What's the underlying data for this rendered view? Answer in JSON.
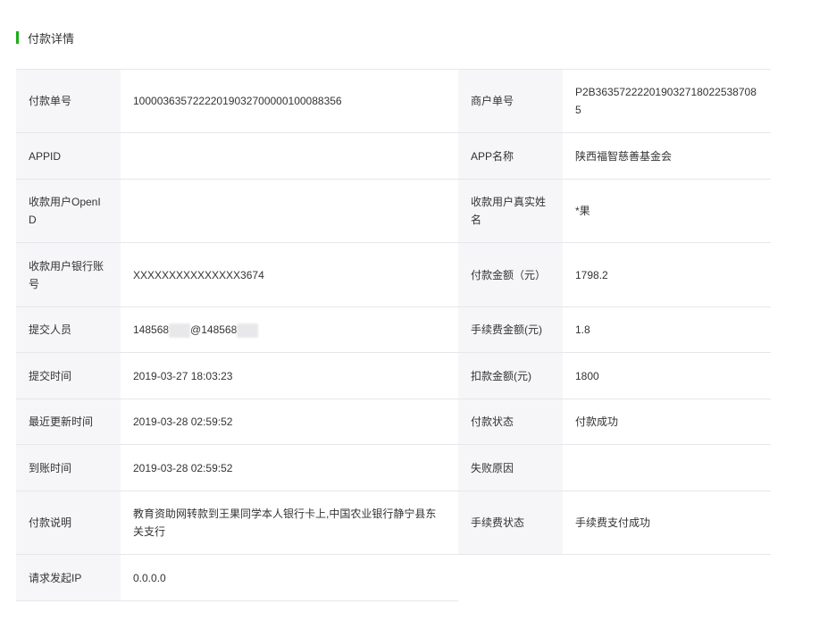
{
  "header": {
    "title": "付款详情"
  },
  "rows": [
    {
      "label_left": "付款单号",
      "value_left": "10000363572222019032700000100088356",
      "label_right": "商户单号",
      "value_right": "P2B363572222019032718022538708 5"
    },
    {
      "label_left": "APPID",
      "value_left": "",
      "label_right": "APP名称",
      "value_right": "陕西福智慈善基金会"
    },
    {
      "label_left": "收款用户OpenID",
      "value_left": "",
      "label_right": "收款用户真实姓名",
      "value_right": "*果"
    },
    {
      "label_left": "收款用户银行账号",
      "value_left": "XXXXXXXXXXXXXXX3674",
      "label_right": "付款金额（元）",
      "value_right": "1798.2"
    },
    {
      "label_left": "提交人员",
      "value_left_part1": "148568",
      "value_left_part2": "@148568",
      "label_right": "手续费金额(元)",
      "value_right": "1.8"
    },
    {
      "label_left": "提交时间",
      "value_left": "2019-03-27 18:03:23",
      "label_right": "扣款金额(元)",
      "value_right": "1800"
    },
    {
      "label_left": "最近更新时间",
      "value_left": "2019-03-28 02:59:52",
      "label_right": "付款状态",
      "value_right": "付款成功"
    },
    {
      "label_left": "到账时间",
      "value_left": "2019-03-28 02:59:52",
      "label_right": "失败原因",
      "value_right": ""
    },
    {
      "label_left": "付款说明",
      "value_left": "教育资助网转款到王果同学本人银行卡上,中国农业银行静宁县东关支行",
      "label_right": "手续费状态",
      "value_right": "手续费支付成功"
    },
    {
      "label_left": "请求发起IP",
      "value_left": "0.0.0.0"
    }
  ],
  "colors": {
    "accent": "#1aad19",
    "label_bg": "#f6f6f8",
    "border": "#e7e7eb"
  }
}
